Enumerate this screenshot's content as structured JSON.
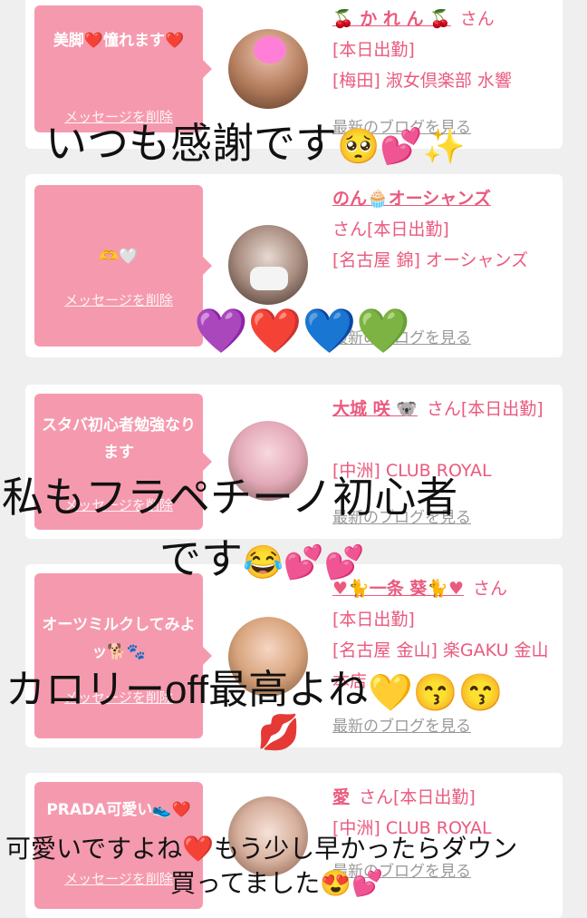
{
  "cards": [
    {
      "message": "美脚❤️憧れます❤️",
      "delete_label": "メッセージを削除",
      "name": "🍒 か れ ん 🍒",
      "san": "さん",
      "status": "[本日出勤]",
      "shop": "[梅田] 淑女倶楽部 水響",
      "blog_link": "最新のブログを見る"
    },
    {
      "message": "🫶🤍",
      "delete_label": "メッセージを削除",
      "name": "のん🧁オーシャンズ",
      "san_status": "さん[本日出勤]",
      "shop": "[名古屋 錦] オーシャンズ",
      "blog_link": "最新のブログを見る"
    },
    {
      "message": "スタバ初心者勉強なります",
      "delete_label": "メッセージを削除",
      "name": "大城 咲 🐨",
      "san_status": "さん[本日出勤]",
      "shop": "[中洲] CLUB ROYAL",
      "blog_link": "最新のブログを見る"
    },
    {
      "message": "オーツミルクしてみよッ🐕🐾",
      "delete_label": "メッセージを削除",
      "name": "♥🐈一条 葵🐈♥",
      "san": "さん",
      "status": "[本日出勤]",
      "shop": "[名古屋 金山] 楽GAKU 金山本店",
      "blog_link": "最新のブログを見る"
    },
    {
      "message": "PRADA可愛い👟❤️",
      "delete_label": "メッセージを削除",
      "name": "愛",
      "san_status": "さん[本日出勤]",
      "shop": "[中洲] CLUB ROYAL",
      "blog_link": "最新のブログを見る"
    }
  ],
  "overlays": {
    "line1": "いつも感謝です",
    "line1_emoji": "🥺💕✨",
    "line2_emoji": "💜❤️💙💚",
    "line3a": "私もフラペチーノ初心者",
    "line3b": "です",
    "line3b_emoji": "😂💕💕",
    "line4": "カロリーoff最高よね",
    "line4_emoji": "💛😙😙",
    "line4_lips": "💋",
    "line5a": "可愛いですよね",
    "line5a_heart": "❤️",
    "line5a_rest": "もう少し早かったらダウン",
    "line5b": "買ってました",
    "line5b_emoji": "😍💕"
  },
  "colors": {
    "accent": "#ea5a7e",
    "bubble": "#f59aae",
    "background": "#efefef"
  }
}
